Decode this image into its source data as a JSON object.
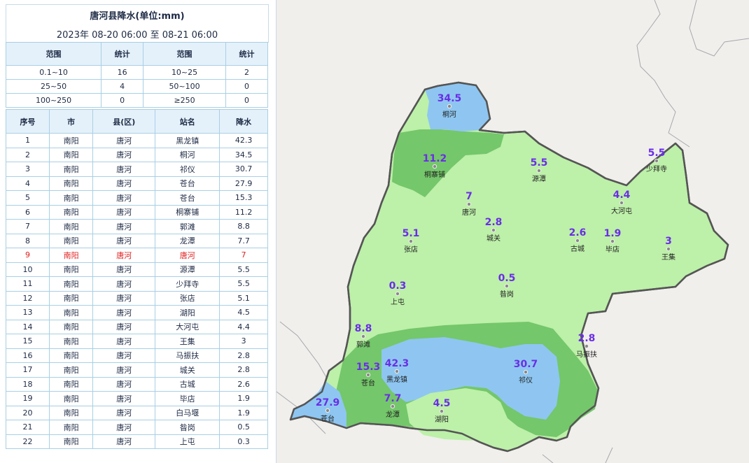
{
  "header": {
    "title": "唐河县降水(单位:mm)",
    "subtitle": "2023年 08-20 06:00 至 08-21 06:00"
  },
  "range_table": {
    "columns": [
      "范围",
      "统计",
      "范围",
      "统计"
    ],
    "rows": [
      [
        "0.1~10",
        "16",
        "10~25",
        "2"
      ],
      [
        "25~50",
        "4",
        "50~100",
        "0"
      ],
      [
        "100~250",
        "0",
        "≥250",
        "0"
      ]
    ]
  },
  "station_table": {
    "columns": [
      "序号",
      "市",
      "县(区)",
      "站名",
      "降水"
    ],
    "highlight_row": 9,
    "rows": [
      [
        "1",
        "南阳",
        "唐河",
        "黑龙镇",
        "42.3"
      ],
      [
        "2",
        "南阳",
        "唐河",
        "桐河",
        "34.5"
      ],
      [
        "3",
        "南阳",
        "唐河",
        "祁仪",
        "30.7"
      ],
      [
        "4",
        "南阳",
        "唐河",
        "苍台",
        "27.9"
      ],
      [
        "5",
        "南阳",
        "唐河",
        "苍台",
        "15.3"
      ],
      [
        "6",
        "南阳",
        "唐河",
        "桐寨铺",
        "11.2"
      ],
      [
        "7",
        "南阳",
        "唐河",
        "郭滩",
        "8.8"
      ],
      [
        "8",
        "南阳",
        "唐河",
        "龙潭",
        "7.7"
      ],
      [
        "9",
        "南阳",
        "唐河",
        "唐河",
        "7"
      ],
      [
        "10",
        "南阳",
        "唐河",
        "源潭",
        "5.5"
      ],
      [
        "11",
        "南阳",
        "唐河",
        "少拜寺",
        "5.5"
      ],
      [
        "12",
        "南阳",
        "唐河",
        "张店",
        "5.1"
      ],
      [
        "13",
        "南阳",
        "唐河",
        "湖阳",
        "4.5"
      ],
      [
        "14",
        "南阳",
        "唐河",
        "大河屯",
        "4.4"
      ],
      [
        "15",
        "南阳",
        "唐河",
        "王集",
        "3"
      ],
      [
        "16",
        "南阳",
        "唐河",
        "马振扶",
        "2.8"
      ],
      [
        "17",
        "南阳",
        "唐河",
        "城关",
        "2.8"
      ],
      [
        "18",
        "南阳",
        "唐河",
        "古城",
        "2.6"
      ],
      [
        "19",
        "南阳",
        "唐河",
        "毕店",
        "1.9"
      ],
      [
        "20",
        "南阳",
        "唐河",
        "白马堰",
        "1.9"
      ],
      [
        "21",
        "南阳",
        "唐河",
        "昝岗",
        "0.5"
      ],
      [
        "22",
        "南阳",
        "唐河",
        "上屯",
        "0.3"
      ]
    ]
  },
  "map": {
    "colors": {
      "band_0_1_10": "#bdf0a9",
      "band_10_25": "#74c76a",
      "band_25_50": "#8ec6f1",
      "boundary": "#555555",
      "outside": "#f0efec",
      "value_text": "#6a2ee6"
    },
    "stations": [
      {
        "name": "桐河",
        "value": "34.5"
      },
      {
        "name": "桐寨铺",
        "value": "11.2"
      },
      {
        "name": "源潭",
        "value": "5.5"
      },
      {
        "name": "少拜寺",
        "value": "5.5"
      },
      {
        "name": "唐河",
        "value": "7"
      },
      {
        "name": "大河屯",
        "value": "4.4"
      },
      {
        "name": "城关",
        "value": "2.8"
      },
      {
        "name": "张店",
        "value": "5.1"
      },
      {
        "name": "古城",
        "value": "2.6"
      },
      {
        "name": "毕店",
        "value": "1.9"
      },
      {
        "name": "王集",
        "value": "3"
      },
      {
        "name": "上屯",
        "value": "0.3"
      },
      {
        "name": "昝岗",
        "value": "0.5"
      },
      {
        "name": "郭滩",
        "value": "8.8"
      },
      {
        "name": "马振扶",
        "value": "2.8"
      },
      {
        "name": "苍台",
        "value": "15.3"
      },
      {
        "name": "黑龙镇",
        "value": "42.3"
      },
      {
        "name": "祁仪",
        "value": "30.7"
      },
      {
        "name": "龙潭",
        "value": "7.7"
      },
      {
        "name": "湖阳",
        "value": "4.5"
      },
      {
        "name": "苍台",
        "value": "27.9"
      }
    ]
  }
}
